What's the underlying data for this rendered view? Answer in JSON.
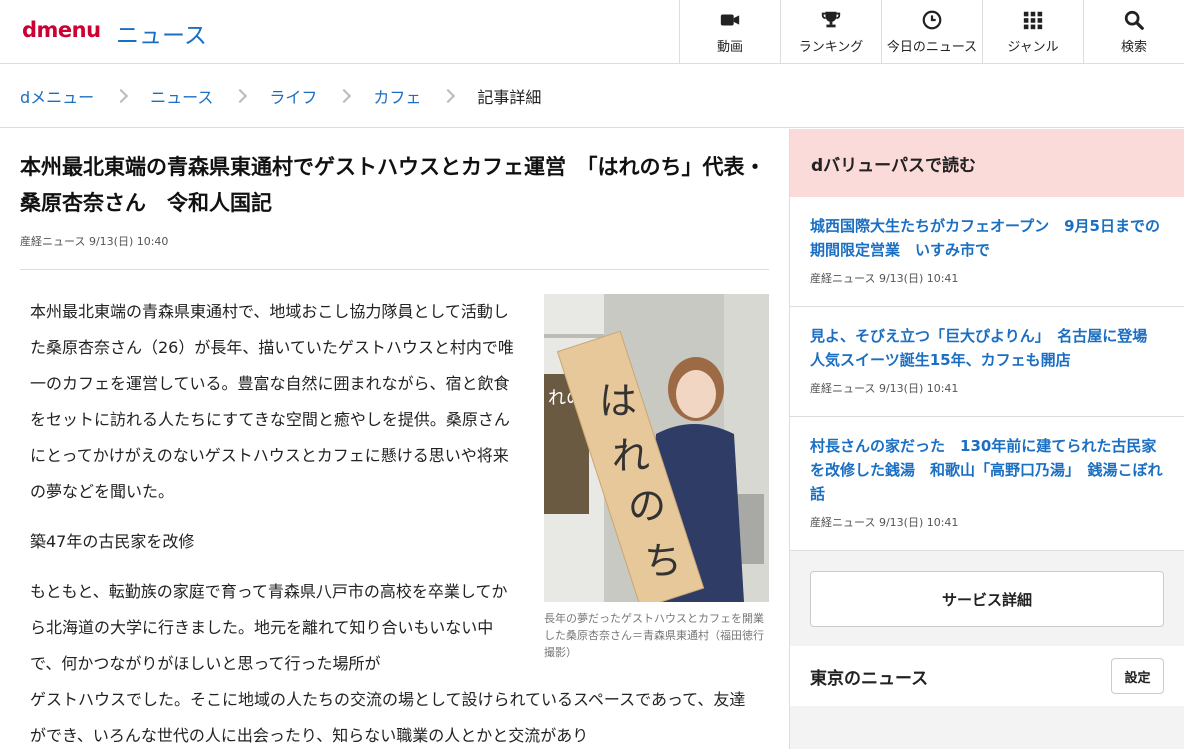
{
  "header": {
    "logo": {
      "d": "d",
      "menu": "menu"
    },
    "section": "ニュース",
    "nav": [
      {
        "label": "動画",
        "icon": "video-camera-icon"
      },
      {
        "label": "ランキング",
        "icon": "trophy-icon"
      },
      {
        "label": "今日のニュース",
        "icon": "clock-icon"
      },
      {
        "label": "ジャンル",
        "icon": "grid-icon"
      },
      {
        "label": "検索",
        "icon": "search-icon"
      }
    ]
  },
  "breadcrumb": [
    "dメニュー",
    "ニュース",
    "ライフ",
    "カフェ",
    "記事詳細"
  ],
  "article": {
    "title": "本州最北東端の青森県東通村でゲストハウスとカフェ運営　「はれのち」代表・桑原杏奈さん　令和人国記",
    "meta": "産経ニュース 9/13(日) 10:40",
    "p1": "本州最北東端の青森県東通村で、地域おこし協力隊員として活動した桑原杏奈さん（26）が長年、描いていたゲストハウスと村内で唯一のカフェを運営している。豊富な自然に囲まれながら、宿と飲食をセットに訪れる人たちにすてきな空間と癒やしを提供。桑原さんにとってかけがえのないゲストハウスとカフェに懸ける思いや将来の夢などを聞いた。",
    "subheading": "築47年の古民家を改修",
    "p2": "もともと、転勤族の家庭で育って青森県八戸市の高校を卒業してから北海道の大学に行きました。地元を離れて知り合いもいない中で、何かつながりがほしいと思って行った場所が",
    "p2b": "ゲストハウスでした。そこに地域の人たちの交流の場として設けられているスペースであって、友達ができ、いろんな世代の人に出会ったり、知らない職業の人とかと交流があり",
    "photo_sign": "はれのち",
    "photo_wall": "れの",
    "caption": "長年の夢だったゲストハウスとカフェを開業した桑原杏奈さん＝青森県東通村（福田徳行撮影）"
  },
  "sidebar": {
    "heading": "dバリューパスで読む",
    "items": [
      {
        "title": "城西国際大生たちがカフェオープン　9月5日までの期間限定営業　いすみ市で",
        "meta": "産経ニュース 9/13(日) 10:41"
      },
      {
        "title": "見よ、そびえ立つ「巨大ぴよりん」　名古屋に登場　人気スイーツ誕生15年、カフェも開店",
        "meta": "産経ニュース 9/13(日) 10:41"
      },
      {
        "title": "村長さんの家だった　130年前に建てられた古民家を改修した銭湯　和歌山「高野口乃湯」　銭湯こぼれ話",
        "meta": "産経ニュース 9/13(日) 10:41"
      }
    ],
    "service_button": "サービス詳細",
    "tokyo_title": "東京のニュース",
    "settings_button": "設定"
  }
}
